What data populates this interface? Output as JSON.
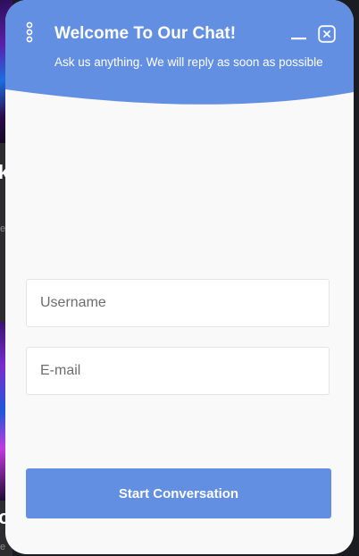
{
  "chat": {
    "title": "Welcome To Our Chat!",
    "subtitle": "Ask us anything. We will reply as soon as possible",
    "username_placeholder": "Username",
    "email_placeholder": "E-mail",
    "start_label": "Start Conversation",
    "icons": {
      "menu": "vertical-dots-icon",
      "minimize": "minimize-icon",
      "close": "close-icon"
    }
  },
  "colors": {
    "accent": "#628fe2",
    "panel_background": "#f9f9f9",
    "field_border": "#e4e4e4"
  }
}
